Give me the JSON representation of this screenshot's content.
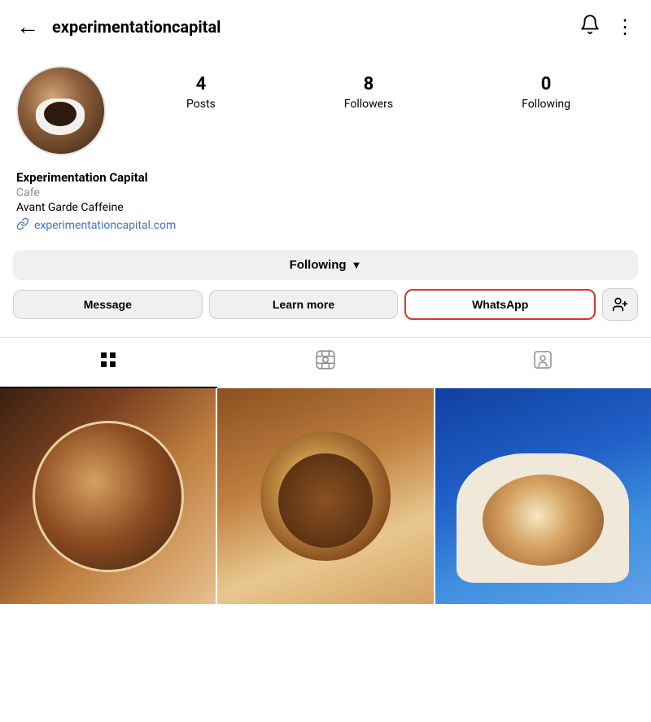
{
  "header": {
    "title": "experimentationcapital",
    "back_label": "←",
    "bell_icon": "🔔",
    "more_icon": "⋮"
  },
  "profile": {
    "name": "Experimentation Capital",
    "category": "Cafe",
    "tagline": "Avant Garde Caffeine",
    "website": "experimentationcapital.com",
    "stats": {
      "posts_count": "4",
      "posts_label": "Posts",
      "followers_count": "8",
      "followers_label": "Followers",
      "following_count": "0",
      "following_label": "Following"
    }
  },
  "buttons": {
    "following_label": "Following",
    "message_label": "Message",
    "learn_more_label": "Learn more",
    "whatsapp_label": "WhatsApp",
    "add_friend_icon": "👤+"
  },
  "tabs": {
    "grid_icon": "⊞",
    "reels_icon": "▶",
    "tagged_icon": "👤"
  }
}
